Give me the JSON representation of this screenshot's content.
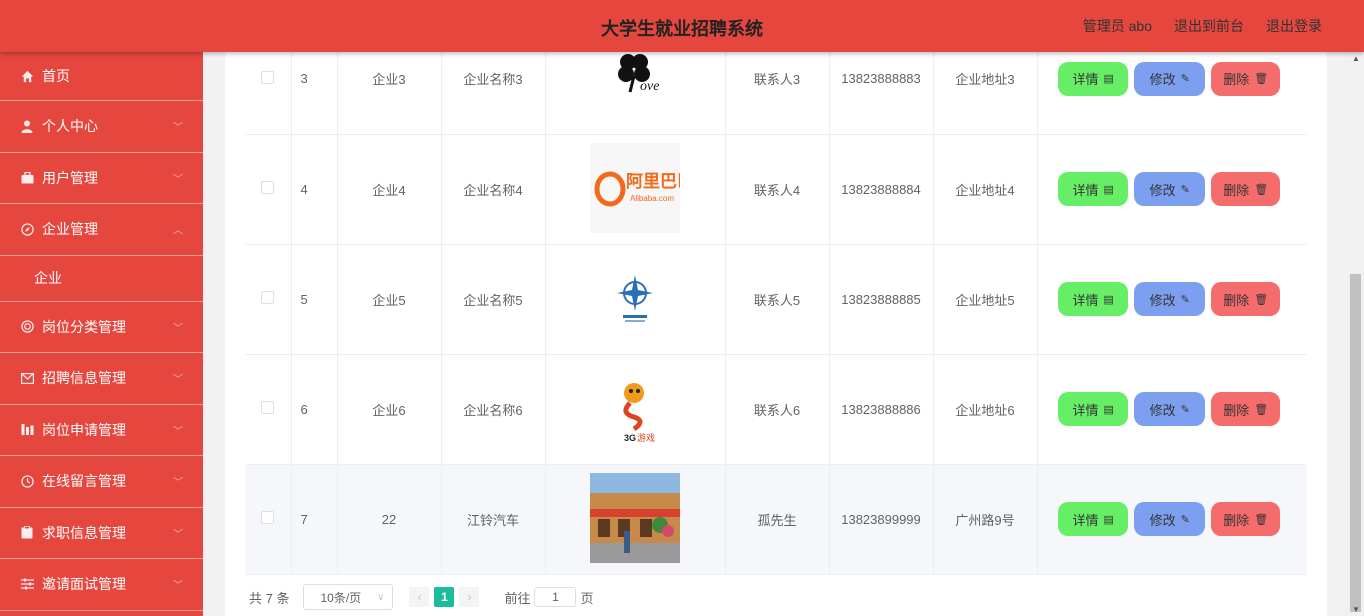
{
  "header": {
    "title": "大学生就业招聘系统",
    "admin": "管理员 abo",
    "to_front": "退出到前台",
    "logout": "退出登录"
  },
  "sidebar": {
    "items": [
      {
        "label": "首页",
        "icon": "home-icon"
      },
      {
        "label": "个人中心",
        "icon": "user-icon"
      },
      {
        "label": "用户管理",
        "icon": "briefcase-icon"
      },
      {
        "label": "企业管理",
        "icon": "compass-icon"
      },
      {
        "label": "企业",
        "icon": ""
      },
      {
        "label": "岗位分类管理",
        "icon": "target-icon"
      },
      {
        "label": "招聘信息管理",
        "icon": "mail-icon"
      },
      {
        "label": "岗位申请管理",
        "icon": "chart-icon"
      },
      {
        "label": "在线留言管理",
        "icon": "clock-icon"
      },
      {
        "label": "求职信息管理",
        "icon": "clipboard-icon"
      },
      {
        "label": "邀请面试管理",
        "icon": "sliders-icon"
      }
    ]
  },
  "table": {
    "rows": [
      {
        "index": "3",
        "account": "企业3",
        "name": "企业名称3",
        "logo": "clover-love-logo",
        "contact": "联系人3",
        "phone": "13823888883",
        "address": "企业地址3"
      },
      {
        "index": "4",
        "account": "企业4",
        "name": "企业名称4",
        "logo": "alibaba-logo",
        "contact": "联系人4",
        "phone": "13823888884",
        "address": "企业地址4"
      },
      {
        "index": "5",
        "account": "企业5",
        "name": "企业名称5",
        "logo": "compass-star-logo",
        "contact": "联系人5",
        "phone": "13823888885",
        "address": "企业地址5"
      },
      {
        "index": "6",
        "account": "企业6",
        "name": "企业名称6",
        "logo": "game-mascot-logo",
        "contact": "联系人6",
        "phone": "13823888886",
        "address": "企业地址6"
      },
      {
        "index": "7",
        "account": "22",
        "name": "江铃汽车",
        "logo": "storefront-photo",
        "contact": "孤先生",
        "phone": "13823899999",
        "address": "广州路9号"
      }
    ],
    "actions": {
      "detail": "详情",
      "edit": "修改",
      "delete": "删除"
    }
  },
  "pager": {
    "total": "共 7 条",
    "page_size": "10条/页",
    "current_page": "1",
    "goto_prefix": "前往",
    "goto_value": "1",
    "goto_suffix": "页"
  },
  "colors": {
    "brand": "#e5473f",
    "detail": "#66ee66",
    "edit": "#7d9ff0",
    "delete": "#f56c6c",
    "active_page": "#1bbc9b"
  }
}
